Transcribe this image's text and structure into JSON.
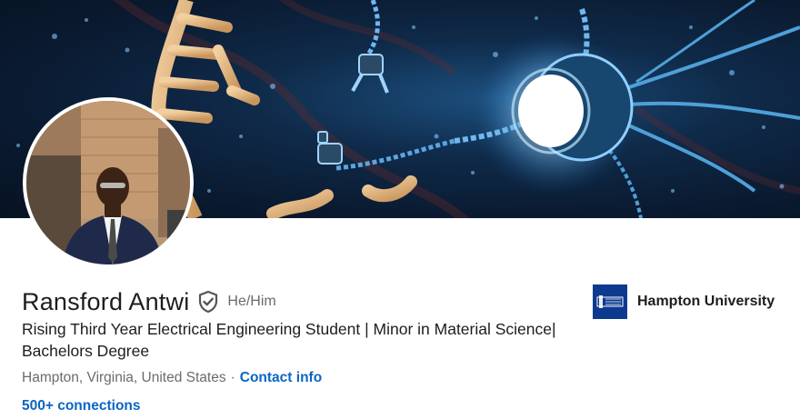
{
  "profile": {
    "name": "Ransford Antwi",
    "pronouns": "He/Him",
    "headline": "Rising Third Year Electrical Engineering Student | Minor in Material Science| Bachelors Degree",
    "location": "Hampton, Virginia, United States",
    "separator": "·",
    "contact_label": "Contact info",
    "connections": "500+ connections"
  },
  "education": {
    "name": "Hampton University",
    "logo_icon": "university-tower-icon"
  },
  "icons": {
    "verified": "verified-shield-icon"
  },
  "colors": {
    "link": "#0a66c2",
    "text": "#1d1d1d",
    "muted": "#6b6b6b",
    "university_logo_bg": "#0d3a8f"
  }
}
